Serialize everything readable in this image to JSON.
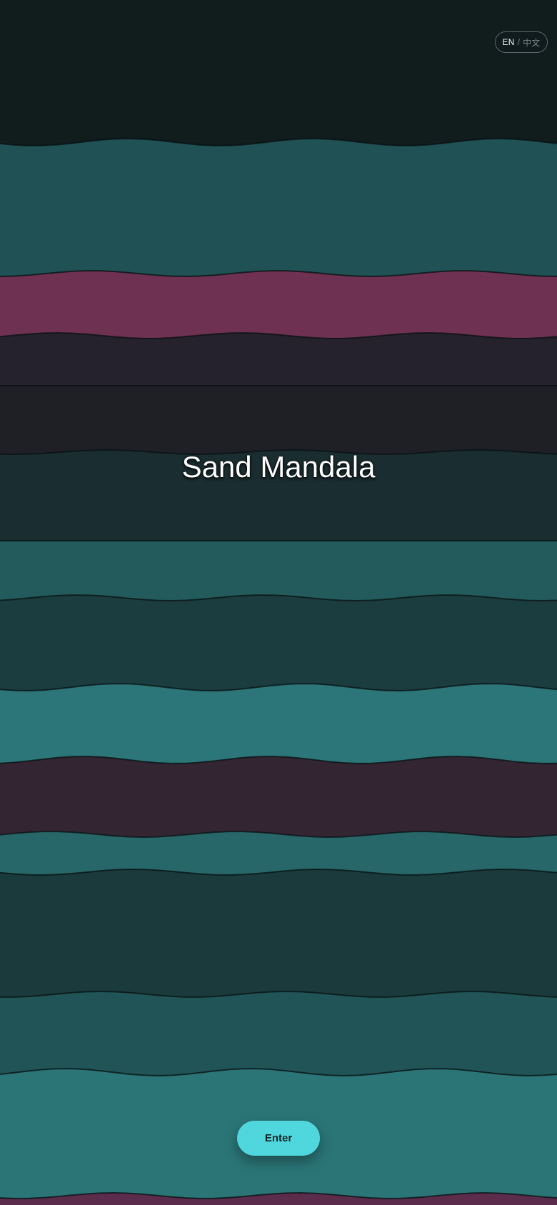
{
  "language": {
    "active": "EN",
    "separator": "/",
    "inactive": "中文"
  },
  "title": "Sand Mandala",
  "enter_label": "Enter",
  "colors": {
    "background": "#111c1d",
    "bands": [
      "#5e2d4b",
      "#1f5155",
      "#6e3152",
      "#25222d",
      "#1e2025",
      "#1a2d30",
      "#235b5c",
      "#1b3d3f",
      "#2c7578",
      "#342533",
      "#276769",
      "#1a3a3c",
      "#205456",
      "#2b7577",
      "#5c2c4c"
    ],
    "accent": "#4fd7dd"
  }
}
